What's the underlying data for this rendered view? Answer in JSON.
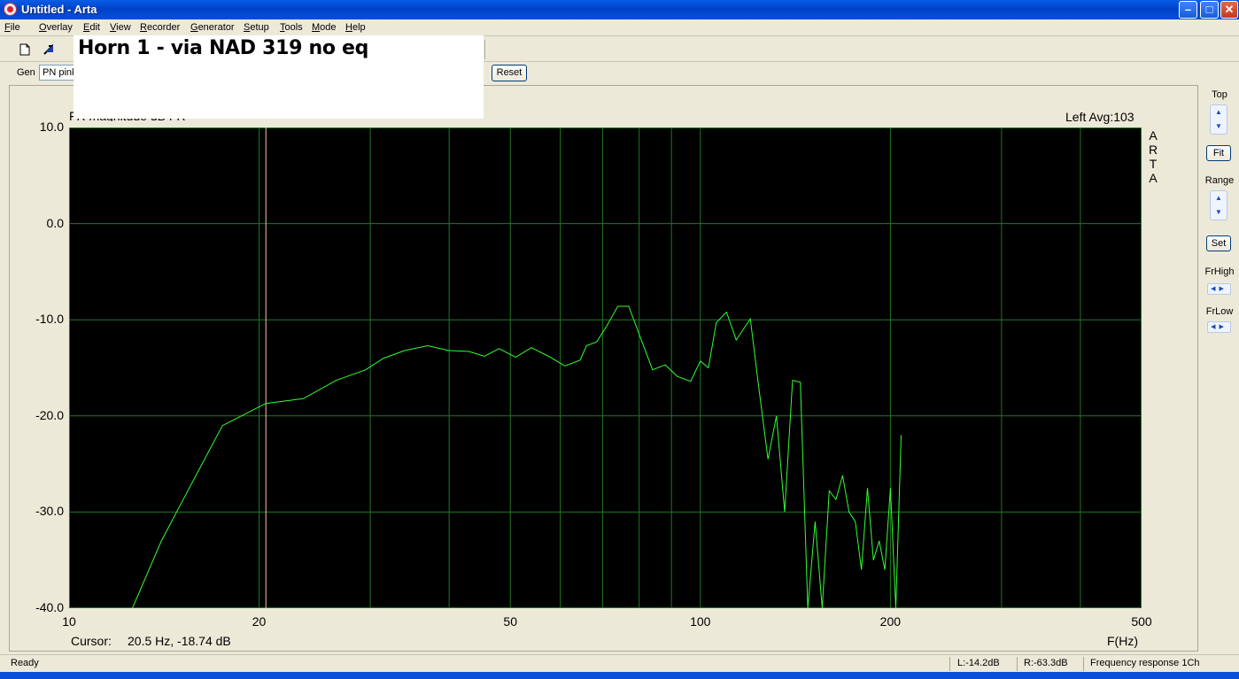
{
  "window": {
    "title": "Untitled - Arta"
  },
  "menu": [
    {
      "underline": "F",
      "rest": "ile"
    },
    {
      "underline": "O",
      "rest": "verlay"
    },
    {
      "underline": "E",
      "rest": "dit"
    },
    {
      "underline": "V",
      "rest": "iew"
    },
    {
      "underline": "R",
      "rest": "ecorder"
    },
    {
      "underline": "G",
      "rest": "enerator"
    },
    {
      "underline": "S",
      "rest": "etup"
    },
    {
      "underline": "T",
      "rest": "ools"
    },
    {
      "underline": "M",
      "rest": "ode"
    },
    {
      "underline": "H",
      "rest": "elp"
    }
  ],
  "genbar": {
    "label": "Gen",
    "selected": "PN pink",
    "reset_label": "Reset"
  },
  "graph_title": "Horn 1 - via NAD 319 no eq",
  "plot": {
    "ylabel_partial": "FR magnitude dB  FR",
    "channel_info": "Left  Avg:103",
    "vertical_brand": [
      "A",
      "R",
      "T",
      "A"
    ],
    "cursor_label": "Cursor:",
    "cursor_value": "20.5 Hz, -18.74 dB",
    "xunit": "F(Hz)"
  },
  "right_panel": {
    "top_label": "Top",
    "fit_label": "Fit",
    "range_label": "Range",
    "set_label": "Set",
    "frhigh_label": "FrHigh",
    "frlow_label": "FrLow"
  },
  "status": {
    "ready": "Ready",
    "left_level": "L:-14.2dB",
    "right_level": "R:-63.3dB",
    "mode": "Frequency response 1Ch"
  },
  "colors": {
    "plot_bg": "#000000",
    "grid": "#1f7a1f",
    "trace": "#33ff33",
    "cursor_line": "#f0c8a0"
  },
  "chart_data": {
    "type": "line",
    "xscale": "log",
    "xlim": [
      10,
      500
    ],
    "ylim": [
      -40,
      10
    ],
    "x_ticks": [
      10,
      20,
      50,
      100,
      200,
      500
    ],
    "x_ticklabels": [
      "10",
      "20",
      "50",
      "100",
      "200",
      "500"
    ],
    "y_ticks": [
      10,
      0,
      -10,
      -20,
      -30,
      -40
    ],
    "y_ticklabels": [
      "10.0",
      "0.0",
      "-10.0",
      "-20.0",
      "-30.0",
      "-40.0"
    ],
    "grid": true,
    "cursor_x": 20.5,
    "series": [
      {
        "x": [
          12.6,
          14.0,
          15.5,
          17.5,
          20.5,
          23.5,
          26.5,
          29.5,
          31.5,
          34.0,
          37.0,
          40.0,
          43.0,
          45.5,
          48.0,
          51.0,
          54.0,
          57.5,
          61.0,
          64.5,
          66.0,
          68.5,
          71.0,
          74.0,
          77.0,
          80.0,
          84.0,
          88.0,
          92.0,
          96.5,
          100.0,
          103.0,
          106.0,
          110.0,
          114.0,
          120.0,
          124.0,
          128.0,
          132.0,
          136.0,
          140.0,
          144.0,
          148.0,
          152.0,
          156.0,
          160.0,
          164.0,
          168.0,
          172.0,
          176.0,
          180.0,
          184.0,
          188.0,
          192.0,
          196.0,
          200.0,
          204.0,
          208.0
        ],
        "y": [
          -40.0,
          -33.0,
          -27.5,
          -21.0,
          -18.7,
          -18.2,
          -16.3,
          -15.2,
          -14.0,
          -13.2,
          -12.7,
          -13.2,
          -13.3,
          -13.8,
          -13.0,
          -13.9,
          -12.9,
          -13.8,
          -14.8,
          -14.2,
          -12.7,
          -12.3,
          -10.7,
          -8.6,
          -8.6,
          -11.5,
          -15.2,
          -14.7,
          -15.9,
          -16.4,
          -14.3,
          -15.0,
          -10.3,
          -9.2,
          -12.1,
          -9.9,
          -17.5,
          -24.5,
          -20.0,
          -30.0,
          -16.3,
          -16.5,
          -40.0,
          -31.0,
          -40.0,
          -27.8,
          -28.7,
          -26.2,
          -30.0,
          -31.0,
          -36.0,
          -27.5,
          -35.0,
          -33.0,
          -36.0,
          -27.5,
          -40.0,
          -22.0
        ]
      }
    ]
  }
}
